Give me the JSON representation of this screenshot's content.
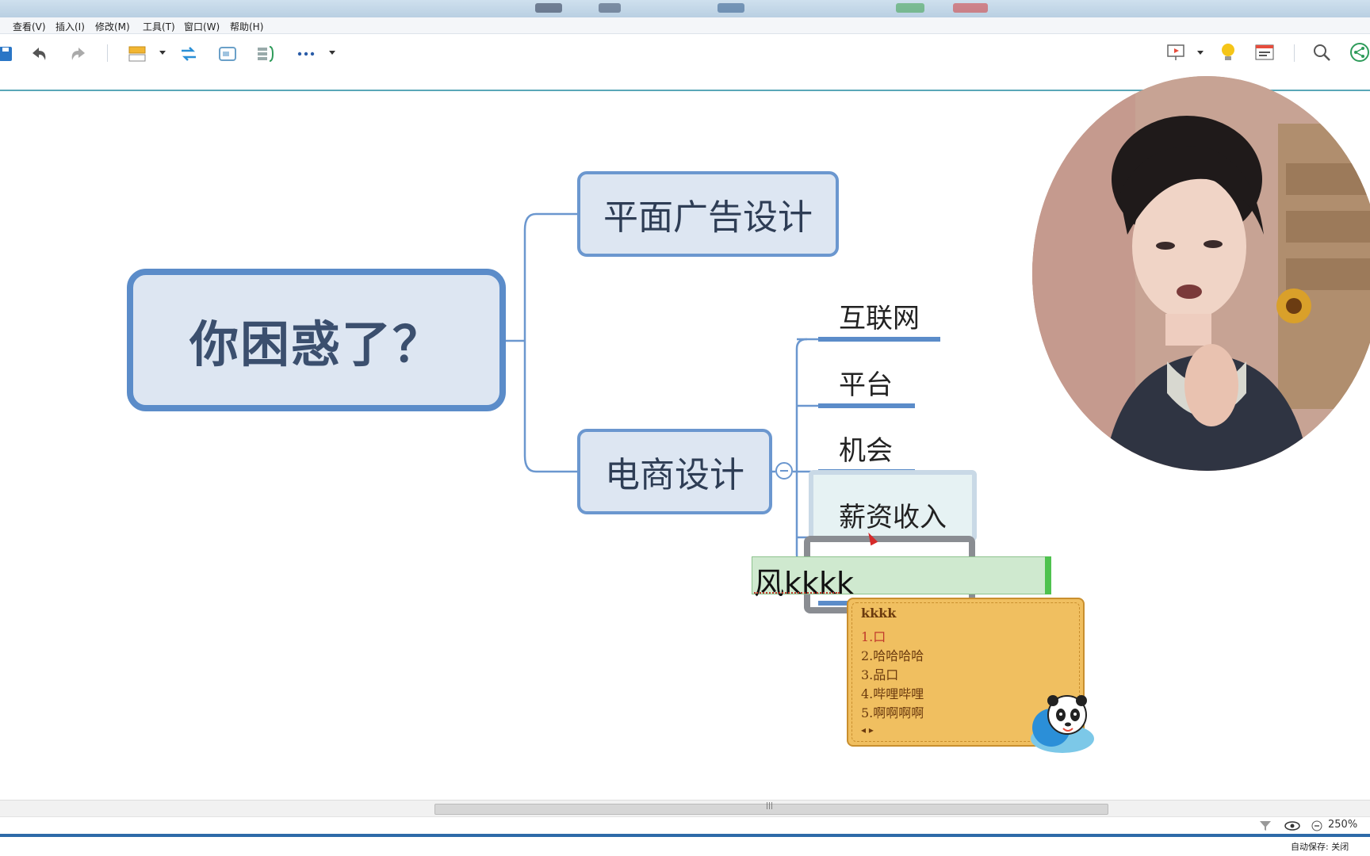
{
  "menu": {
    "items": [
      "查看(V)",
      "插入(I)",
      "修改(M)",
      "工具(T)",
      "窗口(W)",
      "帮助(H)"
    ]
  },
  "mindmap": {
    "root": "你困惑了？",
    "branch1": "平面广告设计",
    "branch2": "电商设计",
    "children": [
      "互联网",
      "平台",
      "机会",
      "薪资收入"
    ]
  },
  "editing": {
    "text": "风kkkk"
  },
  "ime": {
    "code": "kkkk",
    "candidates": [
      "1.口",
      "2.哈哈哈哈",
      "3.品口",
      "4.哔哩哔哩",
      "5.啊啊啊啊"
    ]
  },
  "status": {
    "zoom": "250%",
    "autosave": "自动保存: 关闭"
  },
  "colors": {
    "node_border": "#5b8cc9",
    "node_fill": "#dde6f2",
    "ime_bg": "#f0bf60",
    "edit_bg": "#cfe9cf"
  }
}
